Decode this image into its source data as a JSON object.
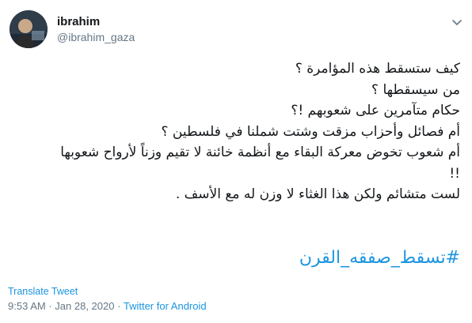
{
  "author": {
    "display_name": "ibrahim",
    "handle": "@ibrahim_gaza"
  },
  "tweet": {
    "lines": [
      "كيف ستسقط هذه المؤامرة ؟",
      "من سيسقطها ؟",
      "حكام متآمرين على شعوبهم !؟",
      "أم فصائل وأحزاب مزقت وشتت شملنا في فلسطين ؟",
      "أم شعوب تخوض معركة البقاء مع أنظمة خائنة لا تقيم وزناً لأرواح شعوبها",
      "!!",
      "لست متشائم ولكن هذا الغثاء لا وزن له مع الأسف ."
    ],
    "hashtag": "#تسقط_صفقه_القرن"
  },
  "footer": {
    "translate_label": "Translate Tweet",
    "time": "9:53 AM",
    "separator": "·",
    "date": "Jan 28, 2020",
    "source": "Twitter for Android"
  },
  "icons": {
    "menu": "chevron-down-icon",
    "avatar": "user-avatar"
  },
  "colors": {
    "link": "#1b95e0",
    "muted": "#657786",
    "text": "#14171a"
  }
}
